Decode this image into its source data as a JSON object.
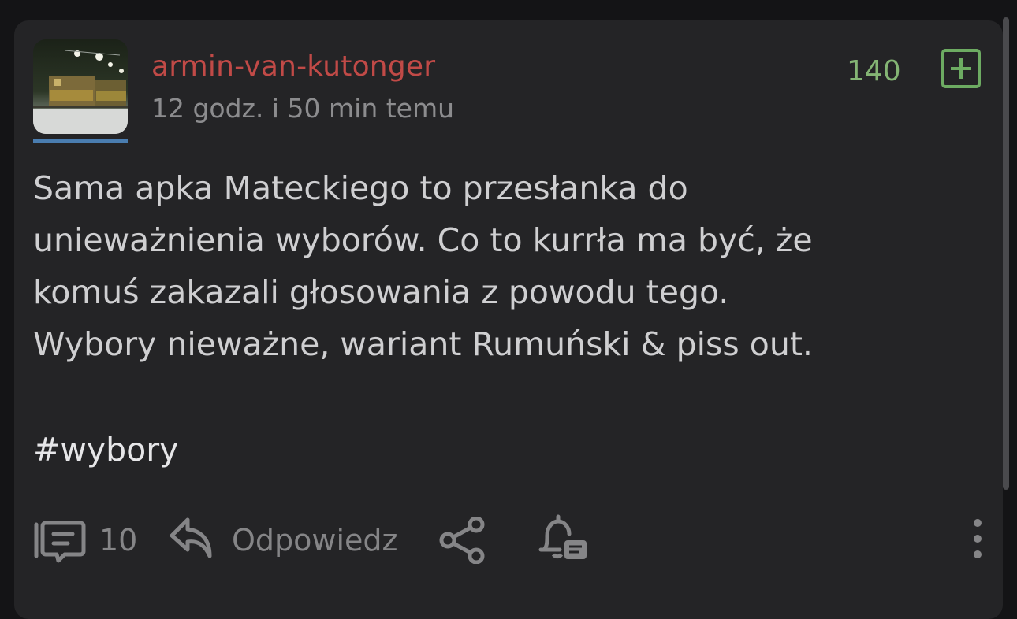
{
  "post": {
    "author": "armin-van-kutonger",
    "timestamp": "12 godz. i 50 min temu",
    "votes": "140",
    "body_lines": [
      "Sama apka Mateckiego to przesłanka do",
      "unieważnienia wyborów. Co to kurrła ma być, że",
      "komuś zakazali głosowania z powodu tego.",
      "Wybory nieważne, wariant Rumuński & piss out."
    ],
    "hashtag": "#wybory"
  },
  "actions": {
    "comments_count": "10",
    "reply_label": "Odpowiedz"
  },
  "colors": {
    "background": "#141416",
    "card": "#242426",
    "author": "#c14a47",
    "votes": "#84b574",
    "plus_border": "#6dab62",
    "muted": "#858587",
    "avatar_underline": "#4a7db0"
  },
  "icons": [
    "plus-square-icon",
    "comments-icon",
    "reply-icon",
    "share-icon",
    "bell-comment-icon",
    "more-vertical-icon"
  ]
}
